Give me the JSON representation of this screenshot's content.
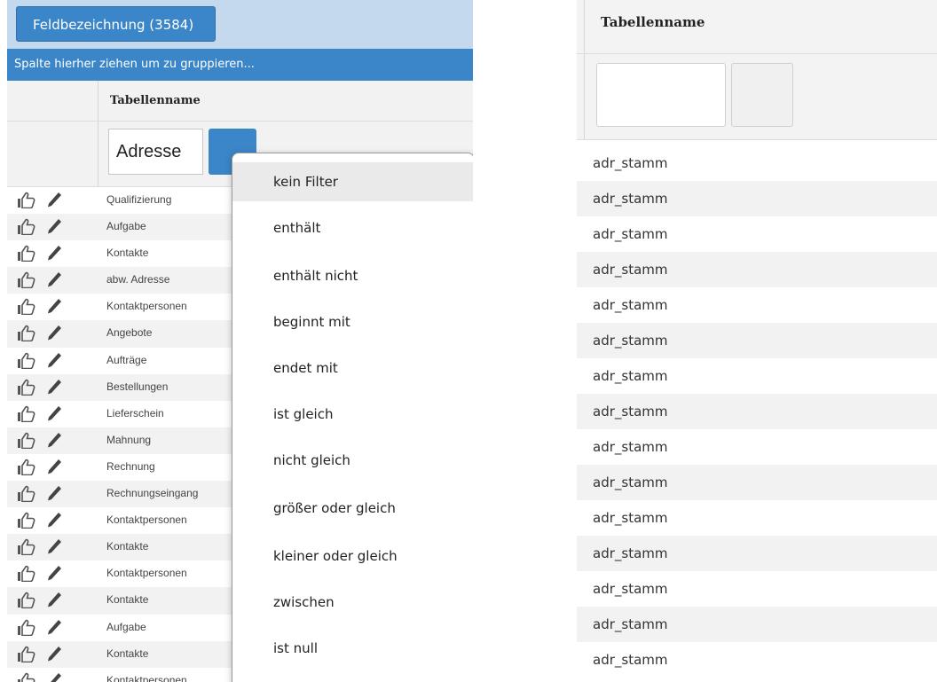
{
  "left": {
    "tab_label": "Feldbezeichnung (3584)",
    "group_hint": "Spalte hierher ziehen um zu gruppieren...",
    "column_header": "Tabellenname",
    "filter_value": "Adresse",
    "rows": [
      "Qualifizierung",
      "Aufgabe",
      "Kontakte",
      "abw. Adresse",
      "Kontaktpersonen",
      "Angebote",
      "Aufträge",
      "Bestellungen",
      "Lieferschein",
      "Mahnung",
      "Rechnung",
      "Rechnungseingang",
      "Kontaktpersonen",
      "Kontakte",
      "Kontaktpersonen",
      "Kontakte",
      "Aufgabe",
      "Kontakte",
      "Kontaktpersonen"
    ]
  },
  "filter_menu": {
    "items": [
      "kein Filter",
      "enthält",
      "enthält nicht",
      "beginnt mit",
      "endet mit",
      "ist gleich",
      "nicht gleich",
      "größer oder gleich",
      "kleiner oder gleich",
      "zwischen",
      "ist null"
    ],
    "selected_index": 0
  },
  "right": {
    "column_header": "Tabellenname",
    "rows": [
      "adr_stamm",
      "adr_stamm",
      "adr_stamm",
      "adr_stamm",
      "adr_stamm",
      "adr_stamm",
      "adr_stamm",
      "adr_stamm",
      "adr_stamm",
      "adr_stamm",
      "adr_stamm",
      "adr_stamm",
      "adr_stamm",
      "adr_stamm",
      "adr_stamm"
    ]
  },
  "colors": {
    "accent": "#3b86c8",
    "tabbar_bg": "#c5d9ee",
    "stripe": "#f2f2f2"
  },
  "icons": {
    "row_action_1": "thumbs-up-icon",
    "row_action_2": "pencil-icon"
  }
}
